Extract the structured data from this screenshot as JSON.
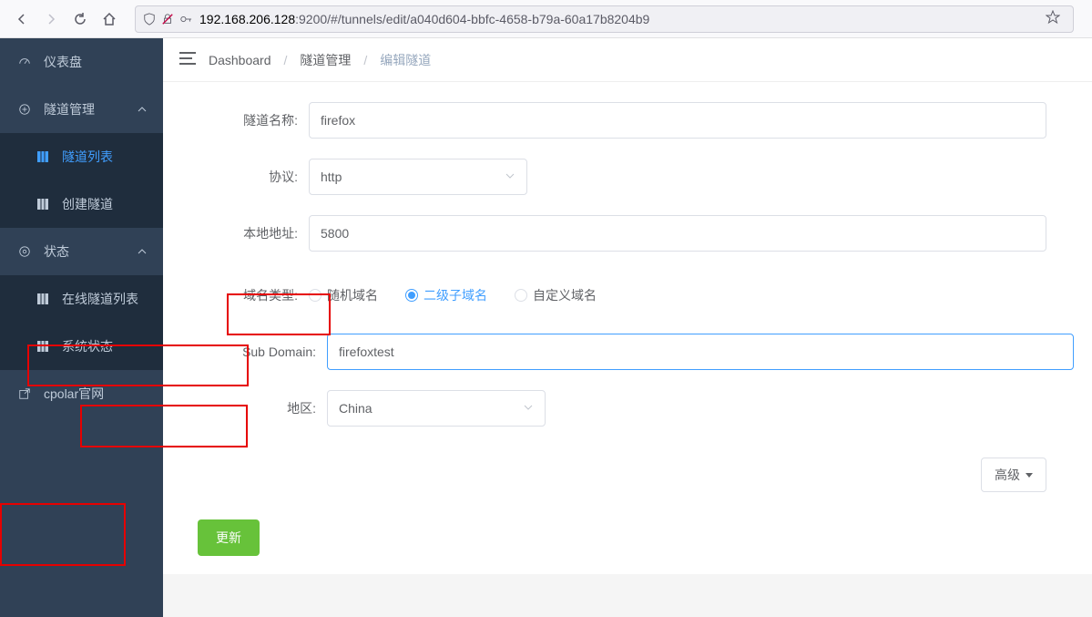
{
  "browser": {
    "url_host": "192.168.206.128",
    "url_rest": ":9200/#/tunnels/edit/a040d604-bbfc-4658-b79a-60a17b8204b9"
  },
  "sidebar": {
    "dashboard": "仪表盘",
    "tunnel_mgmt": "隧道管理",
    "tunnel_list": "隧道列表",
    "tunnel_create": "创建隧道",
    "status": "状态",
    "online_tunnels": "在线隧道列表",
    "system_status": "系统状态",
    "official": "cpolar官网"
  },
  "breadcrumb": {
    "b1": "Dashboard",
    "b2": "隧道管理",
    "b3": "编辑隧道"
  },
  "form": {
    "name_label": "隧道名称:",
    "name_value": "firefox",
    "proto_label": "协议:",
    "proto_value": "http",
    "addr_label": "本地地址:",
    "addr_value": "5800",
    "domain_type_label": "域名类型:",
    "r1": "随机域名",
    "r2": "二级子域名",
    "r3": "自定义域名",
    "sub_label": "Sub Domain:",
    "sub_value": "firefoxtest",
    "region_label": "地区:",
    "region_value": "China",
    "advanced": "高级",
    "submit": "更新"
  }
}
